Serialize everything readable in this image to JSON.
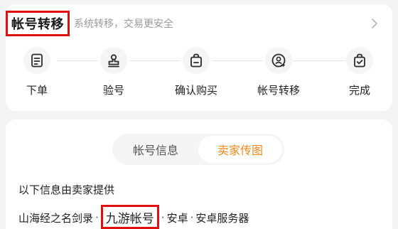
{
  "transfer": {
    "title": "帐号转移",
    "subtitle": "系统转移，交易更安全",
    "chevron_icon": "chevron-right-icon",
    "steps": [
      {
        "label": "下单",
        "icon": "order-document-icon"
      },
      {
        "label": "验号",
        "icon": "stamp-icon"
      },
      {
        "label": "确认购买",
        "icon": "shopping-bag-icon"
      },
      {
        "label": "帐号转移",
        "icon": "account-transfer-icon"
      },
      {
        "label": "完成",
        "icon": "bag-check-icon"
      }
    ]
  },
  "info": {
    "tabs": [
      {
        "label": "帐号信息",
        "active": false
      },
      {
        "label": "卖家传图",
        "active": true
      }
    ],
    "note": "以下信息由卖家提供",
    "details": {
      "game": "山海经之名剑录",
      "platform": "九游帐号",
      "os": "安卓",
      "server": "安卓服务器",
      "separator": "·"
    }
  },
  "colors": {
    "accent_orange": "#f08a1c",
    "highlight_red": "#e01010",
    "muted_text": "#9a9a9a"
  }
}
